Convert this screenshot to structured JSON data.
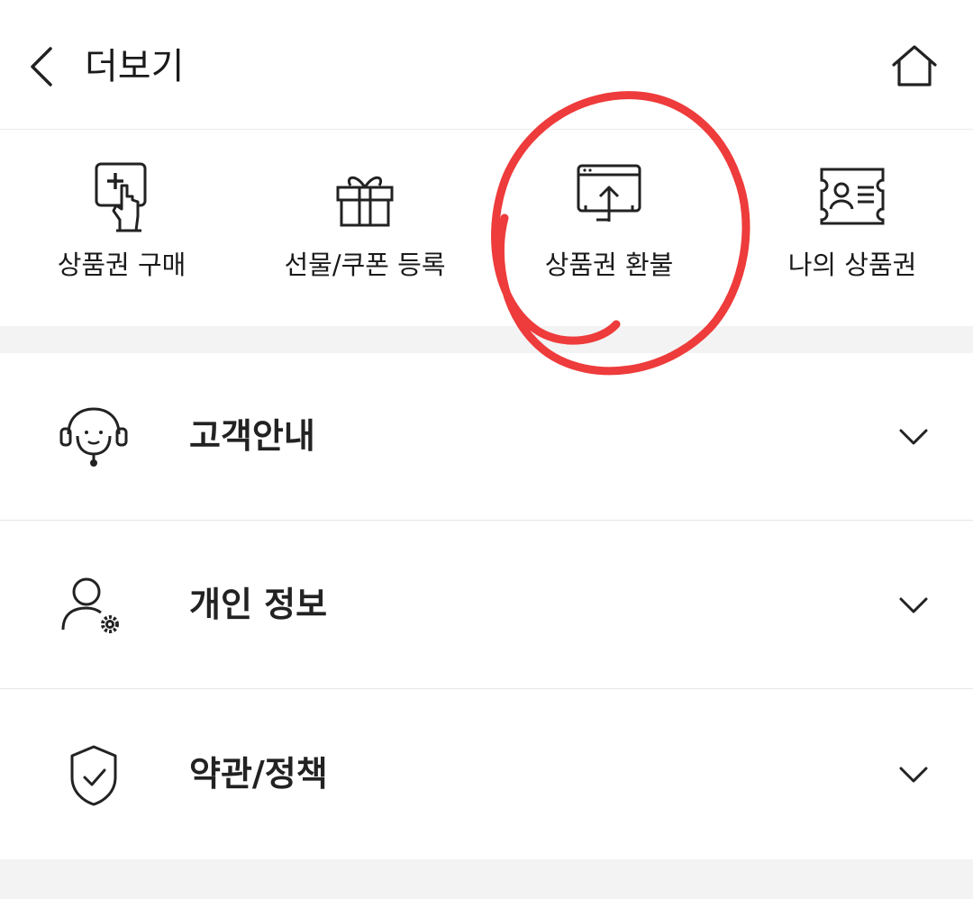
{
  "header": {
    "title": "더보기"
  },
  "quick_menu": [
    {
      "label": "상품권 구매",
      "icon": "purchase-voucher-icon"
    },
    {
      "label": "선물/쿠폰 등록",
      "icon": "gift-icon"
    },
    {
      "label": "상품권 환불",
      "icon": "refund-upload-icon"
    },
    {
      "label": "나의 상품권",
      "icon": "my-voucher-card-icon"
    }
  ],
  "menu_rows": [
    {
      "label": "고객안내",
      "icon": "headset-icon"
    },
    {
      "label": "개인 정보",
      "icon": "user-settings-icon"
    },
    {
      "label": "약관/정책",
      "icon": "shield-check-icon"
    }
  ],
  "annotation": {
    "color": "#ee3b3b",
    "shape": "hand-drawn circle around 상품권 환불"
  }
}
